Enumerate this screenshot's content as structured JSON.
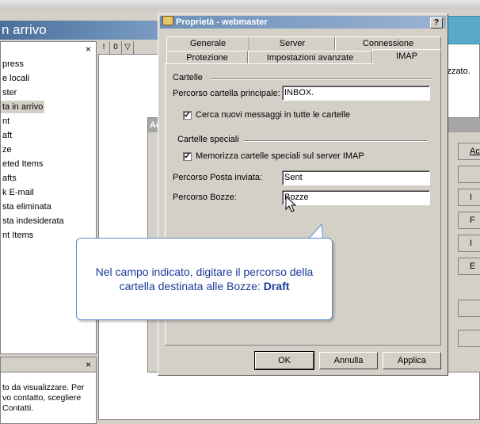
{
  "background_app": {
    "folder_header": "n arrivo",
    "folders": [
      "press",
      "e locali",
      "ster",
      "ta in arrivo",
      "nt",
      "aft",
      "ze",
      "eted Items",
      "afts",
      "k E-mail",
      "sta eliminata",
      "sta indesiderata",
      "nt Items"
    ],
    "selected_folder_index": 3,
    "close_glyph": "×",
    "message_columns": [
      "!",
      "0",
      "▽"
    ],
    "message_pane_note": "izzato.",
    "contacts_text": "to da visualizzare. Per vo contatto, scegliere Contatti.",
    "hidden_panel_label": "Ac",
    "right_buttons": [
      "Ac",
      "",
      "I",
      "F",
      "I",
      "E",
      "",
      ""
    ]
  },
  "dialog": {
    "title": "Proprietà - webmaster",
    "help_button": "?",
    "tabs_row1": [
      "Generale",
      "Server",
      "Connessione"
    ],
    "tabs_row2": [
      "Protezione",
      "Impostazioni avanzate",
      "IMAP"
    ],
    "active_tab": "IMAP",
    "group_cartelle": "Cartelle",
    "root_folder_label": "Percorso cartella principale:",
    "root_folder_value": "INBOX.",
    "check_new_label": "Cerca nuovi messaggi in tutte le cartelle",
    "check_new_checked": true,
    "group_special": "Cartelle speciali",
    "store_special_label": "Memorizza cartelle speciali sul server IMAP",
    "store_special_checked": true,
    "sent_label": "Percorso Posta inviata:",
    "sent_value": "Sent",
    "drafts_label": "Percorso Bozze:",
    "drafts_value": "Bozze",
    "ok_button": "OK",
    "cancel_button": "Annulla",
    "apply_button": "Applica"
  },
  "callout": {
    "text": "Nel campo indicato, digitare il percorso della cartella destinata alle Bozze: ",
    "emphasis": "Draft"
  },
  "colors": {
    "accent_callout": "#1a3a9a",
    "titlebar": "#6b8fb8",
    "teal": "#5aa9c9"
  }
}
